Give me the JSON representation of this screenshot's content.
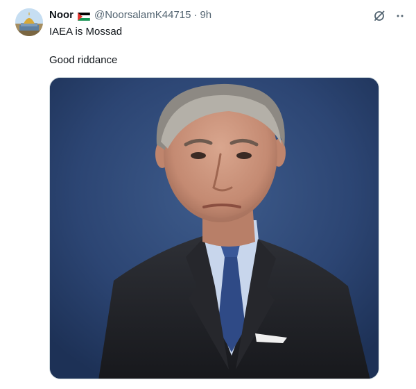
{
  "author": {
    "display_name": "Noor",
    "handle": "@NoorsalamK44715",
    "separator": "·",
    "time": "9h",
    "flag_icon": "palestine-flag-icon",
    "avatar_icon": "dome-of-the-rock-avatar"
  },
  "tweet": {
    "line1": "IAEA is Mossad",
    "line2": "Good riddance"
  },
  "actions": {
    "grok_icon": "grok-icon",
    "more_icon": "more-icon"
  },
  "media": {
    "icon": "portrait-photo"
  },
  "colors": {
    "text": "#0f1419",
    "secondary": "#536471",
    "border": "#cfd9de",
    "photo_background": "#2b4472"
  }
}
